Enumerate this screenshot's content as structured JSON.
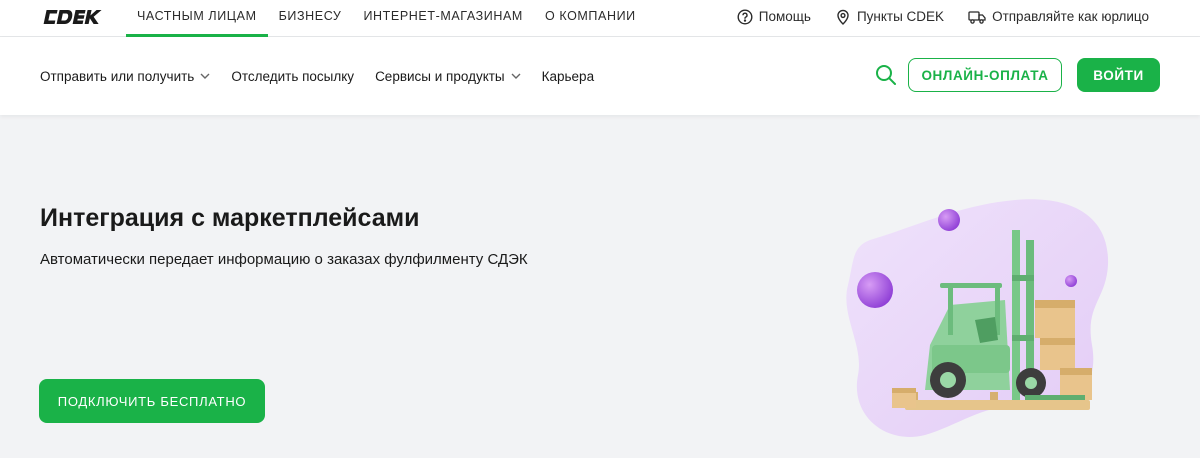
{
  "brand": {
    "logo_text": "CDEK",
    "accent": "#1ab248"
  },
  "top_tabs": [
    {
      "label": "ЧАСТНЫМ ЛИЦАМ",
      "active": true
    },
    {
      "label": "БИЗНЕСУ",
      "active": false
    },
    {
      "label": "ИНТЕРНЕТ-МАГАЗИНАМ",
      "active": false
    },
    {
      "label": "О КОМПАНИИ",
      "active": false
    }
  ],
  "top_links": [
    {
      "label": "Помощь",
      "icon": "help-circle-icon"
    },
    {
      "label": "Пункты CDEK",
      "icon": "map-pin-icon"
    },
    {
      "label": "Отправляйте как юрлицо",
      "icon": "truck-icon"
    }
  ],
  "main_nav": [
    {
      "label": "Отправить или получить",
      "has_dropdown": true
    },
    {
      "label": "Отследить посылку",
      "has_dropdown": false
    },
    {
      "label": "Сервисы и продукты",
      "has_dropdown": true
    },
    {
      "label": "Карьера",
      "has_dropdown": false
    }
  ],
  "actions": {
    "search_icon": "search-icon",
    "pay_label": "ОНЛАЙН-ОПЛАТА",
    "login_label": "ВОЙТИ"
  },
  "hero": {
    "title": "Интеграция с маркетплейсами",
    "subtitle": "Автоматически передает информацию о заказах фулфилменту СДЭК",
    "cta_label": "ПОДКЛЮЧИТЬ БЕСПЛАТНО",
    "illustration": "forklift-with-boxes-illustration"
  }
}
